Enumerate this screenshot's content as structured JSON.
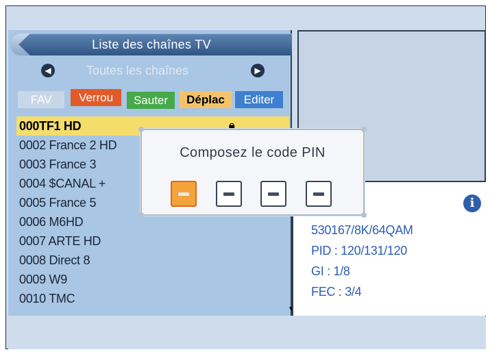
{
  "header": {
    "title": "Liste des chaînes TV"
  },
  "nav": {
    "left_arrow": "◀",
    "label": "Toutes les chaînes",
    "right_arrow": "▶"
  },
  "buttons": {
    "fav": "FAV",
    "verrou": "Verrou",
    "sauter": "Sauter",
    "deplac": "Déplac",
    "editer": "Editer"
  },
  "channels": [
    {
      "label": "000TF1 HD",
      "selected": true
    },
    {
      "label": "0002 France 2 HD"
    },
    {
      "label": "0003 France 3"
    },
    {
      "label": "0004 $CANAL +"
    },
    {
      "label": "0005 France 5"
    },
    {
      "label": "0006 M6HD"
    },
    {
      "label": "0007 ARTE HD"
    },
    {
      "label": "0008 Direct 8"
    },
    {
      "label": "0009 W9"
    },
    {
      "label": "0010 TMC"
    }
  ],
  "info": {
    "line1": "530167/8K/64QAM",
    "line2": "PID : 120/131/120",
    "line3": "GI : 1/8",
    "line4": "FEC : 3/4"
  },
  "pin_dialog": {
    "title": "Composez le code PIN",
    "digits": [
      "–",
      "–",
      "–",
      "–"
    ]
  },
  "colors": {
    "verrou": "#e05a2a",
    "sauter": "#46a94a",
    "deplac": "#f3c36a",
    "editer": "#3f7fd0",
    "selected_row": "#f5dd6c",
    "active_pin": "#f4a33a",
    "info_text": "#2c5db4"
  },
  "icons": {
    "lock": "lock-icon",
    "info": "info-icon"
  }
}
